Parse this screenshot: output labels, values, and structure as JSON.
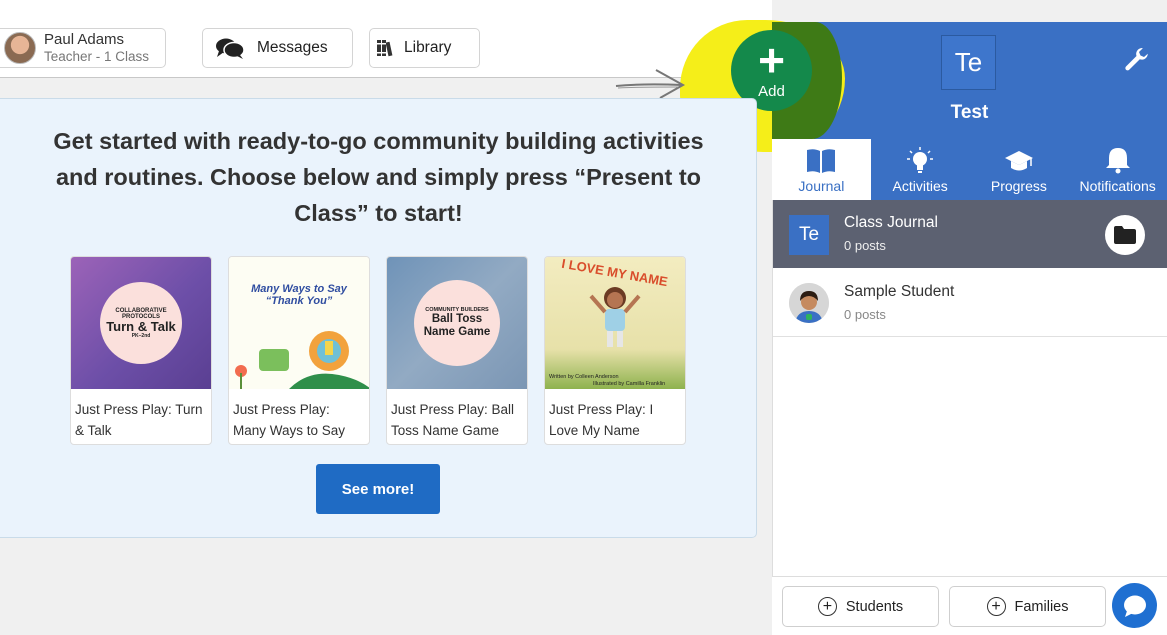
{
  "header": {
    "user_name": "Paul Adams",
    "user_role": "Teacher - 1 Class",
    "messages_label": "Messages",
    "library_label": "Library"
  },
  "add_button": {
    "label": "Add",
    "symbol": "+"
  },
  "class_panel": {
    "badge": "Te",
    "name": "Test",
    "tabs": [
      {
        "label": "Journal",
        "icon": "book-icon",
        "active": true
      },
      {
        "label": "Activities",
        "icon": "lightbulb-icon",
        "active": false
      },
      {
        "label": "Progress",
        "icon": "graduation-cap-icon",
        "active": false
      },
      {
        "label": "Notifications",
        "icon": "bell-icon",
        "active": false
      }
    ],
    "rows": [
      {
        "badge": "Te",
        "title": "Class Journal",
        "sub": "0 posts"
      },
      {
        "title": "Sample Student",
        "sub": "0 posts"
      }
    ],
    "footer": {
      "students_label": "Students",
      "families_label": "Families"
    }
  },
  "main": {
    "headline": "Get started with ready-to-go community building activities and routines. Choose below and simply press “Present to Class” to start!",
    "cards": [
      {
        "title": "Just Press Play: Turn & Talk",
        "thumb_lines": [
          "COLLABORATIVE PROTOCOLS",
          "Turn & Talk",
          "PK–2nd"
        ]
      },
      {
        "title": "Just Press Play: Many Ways to Say",
        "thumb_lines": [
          "Many Ways to Say",
          "“Thank You”"
        ]
      },
      {
        "title": "Just Press Play: Ball Toss Name Game",
        "thumb_lines": [
          "COMMUNITY BUILDERS",
          "Ball Toss Name Game"
        ]
      },
      {
        "title": "Just Press Play: I Love My Name",
        "thumb_lines": [
          "I LOVE MY NAME",
          "Written by Colleen Anderson",
          "Illustrated by Camilla Franklin"
        ]
      }
    ],
    "see_more_label": "See more!"
  },
  "colors": {
    "panel_blue": "#3a70c4",
    "add_green": "#14894b",
    "highlight_yellow": "#f5ee19",
    "journal_row": "#5c6171",
    "see_more_blue": "#1f6bc4"
  }
}
